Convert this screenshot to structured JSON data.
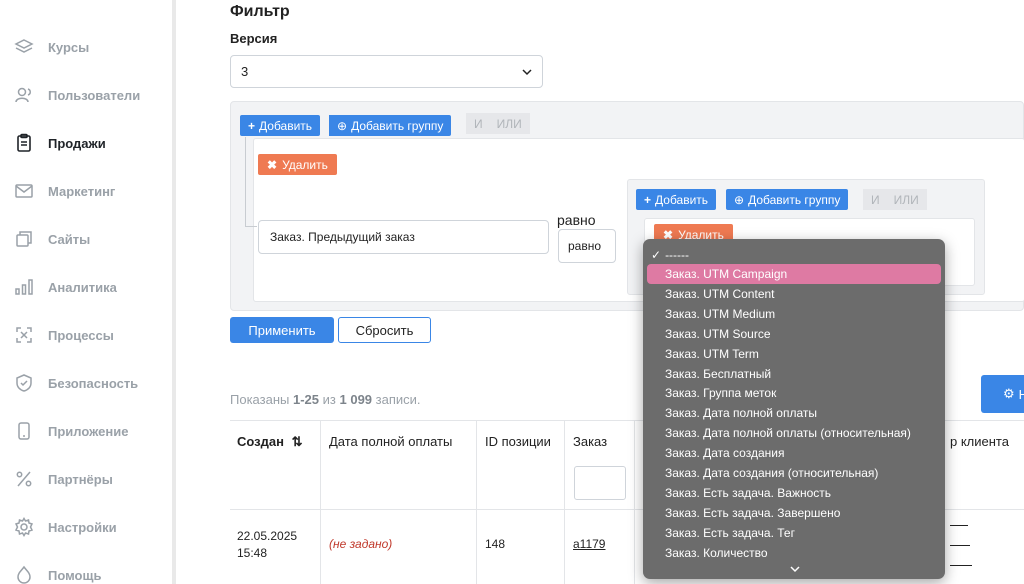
{
  "sidebar": {
    "items": [
      {
        "label": "Курсы",
        "icon": "layers-icon"
      },
      {
        "label": "Пользователи",
        "icon": "users-icon"
      },
      {
        "label": "Продажи",
        "icon": "clipboard-icon",
        "active": true
      },
      {
        "label": "Маркетинг",
        "icon": "mail-icon"
      },
      {
        "label": "Сайты",
        "icon": "windows-icon"
      },
      {
        "label": "Аналитика",
        "icon": "bar-chart-icon"
      },
      {
        "label": "Процессы",
        "icon": "process-icon"
      },
      {
        "label": "Безопасность",
        "icon": "shield-icon"
      },
      {
        "label": "Приложение",
        "icon": "phone-icon"
      },
      {
        "label": "Партнёры",
        "icon": "percent-icon"
      },
      {
        "label": "Настройки",
        "icon": "gear-icon"
      },
      {
        "label": "Помощь",
        "icon": "lifebuoy-icon"
      }
    ]
  },
  "filter": {
    "title": "Фильтр",
    "version_label": "Версия",
    "version_value": "3"
  },
  "builder": {
    "add_label": "Добавить",
    "add_group_label": "Добавить группу",
    "and_label": "И",
    "or_label": "ИЛИ",
    "delete_label": "Удалить",
    "rule_field": "Заказ. Предыдущий заказ",
    "operator_text": "равно",
    "operator_select": "равно"
  },
  "actions": {
    "apply": "Применить",
    "reset": "Сбросить"
  },
  "summary": {
    "prefix": "Показаны",
    "range": "1-25",
    "middle": "из",
    "total": "1 099",
    "suffix": "записи."
  },
  "settings_button_text": "Н",
  "table": {
    "headers": {
      "created": "Создан",
      "paid_date": "Дата полной оплаты",
      "position_id": "ID позиции",
      "order": "Заказ",
      "client_tail": "р клиента"
    },
    "row": {
      "created": "22.05.2025 15:48",
      "paid_date": "(не задано)",
      "position_id": "148",
      "order": "a1179"
    }
  },
  "dropdown": {
    "first": "------",
    "selected_index": 1,
    "items": [
      "Заказ. UTM Campaign",
      "Заказ. UTM Content",
      "Заказ. UTM Medium",
      "Заказ. UTM Source",
      "Заказ. UTM Term",
      "Заказ. Бесплатный",
      "Заказ. Группа меток",
      "Заказ. Дата полной оплаты",
      "Заказ. Дата полной оплаты (относительная)",
      "Заказ. Дата создания",
      "Заказ. Дата создания (относительная)",
      "Заказ. Есть задача. Важность",
      "Заказ. Есть задача. Завершено",
      "Заказ. Есть задача. Тег",
      "Заказ. Количество"
    ]
  },
  "colors": {
    "accent": "#3a86e6",
    "danger": "#ef7a52",
    "dropdown_bg": "#6c6c6c",
    "dropdown_selected": "#de7aa3"
  }
}
